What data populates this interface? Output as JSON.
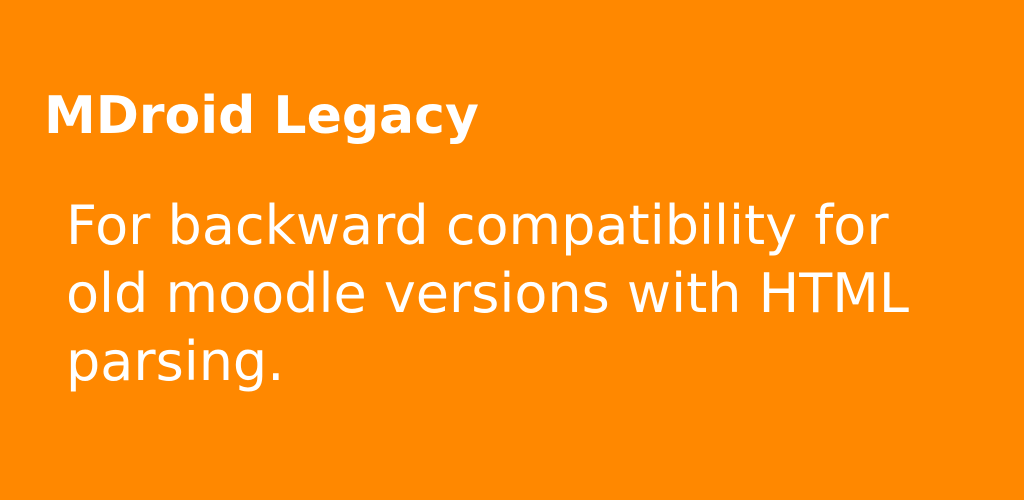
{
  "banner": {
    "title": "MDroid Legacy",
    "description": "For backward compatibility for old moodle versions with HTML parsing.",
    "background_color": "#ff8800",
    "text_color": "#ffffff"
  }
}
